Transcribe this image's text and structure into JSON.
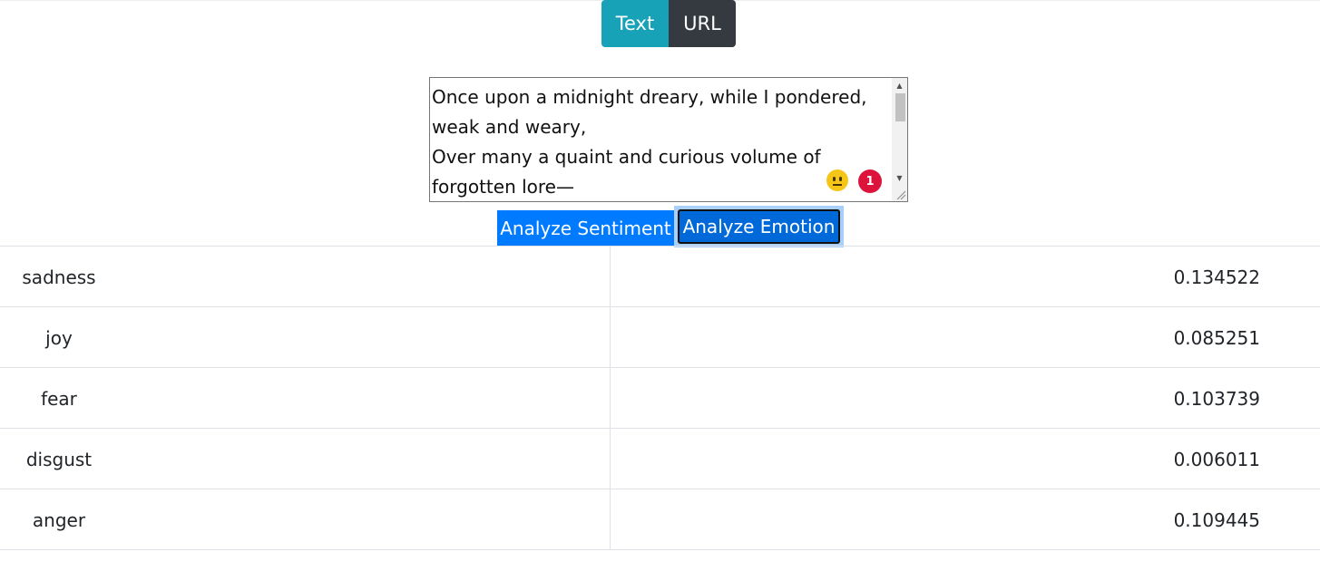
{
  "mode_toggle": {
    "text_label": "Text",
    "url_label": "URL",
    "active": "Text",
    "colors": {
      "text": "#17a2b8",
      "url": "#343a40"
    }
  },
  "input": {
    "value": "Once upon a midnight dreary, while I pondered, weak and weary,\nOver many a quaint and curious volume of forgotten lore—",
    "emoji_icon": "neutral-face-icon",
    "badge_count": "1"
  },
  "actions": {
    "sentiment_label": "Analyze Sentiment",
    "emotion_label": "Analyze Emotion",
    "focused": "Analyze Emotion"
  },
  "results": {
    "rows": [
      {
        "label": "sadness",
        "value": "0.134522"
      },
      {
        "label": "joy",
        "value": "0.085251"
      },
      {
        "label": "fear",
        "value": "0.103739"
      },
      {
        "label": "disgust",
        "value": "0.006011"
      },
      {
        "label": "anger",
        "value": "0.109445"
      }
    ]
  }
}
